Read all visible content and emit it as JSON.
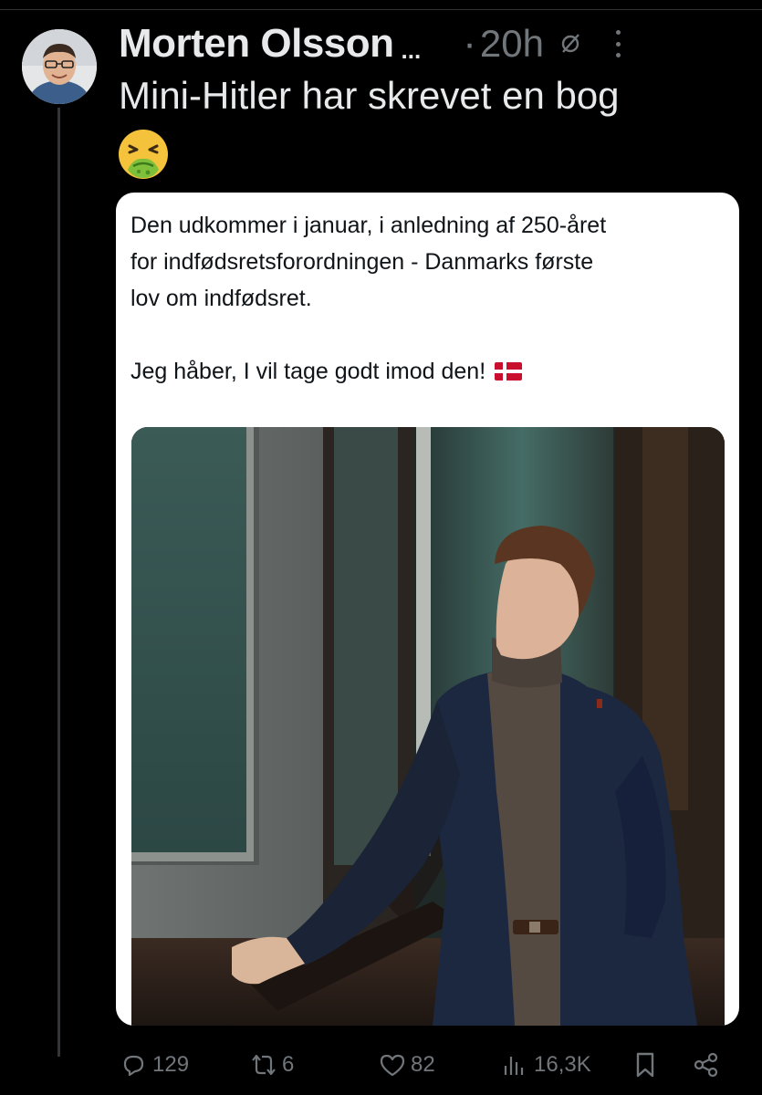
{
  "post": {
    "author": "Morten Olsson",
    "ellipsis": "...",
    "dot": "·",
    "time": "20h",
    "text": "Mini-Hitler har skrevet en bog",
    "emoji": "nauseated-face-emoji"
  },
  "quoted": {
    "line1": "Den udkommer i januar, i anledning af 250-året",
    "line2": "for indfødsretsforordningen - Danmarks første",
    "line3": "lov om indfødsret.",
    "line4": "Jeg håber, I vil tage godt imod den!",
    "flag": "danish-flag-emoji"
  },
  "actions": {
    "replies": "129",
    "reposts": "6",
    "likes": "82",
    "views": "16,3K"
  },
  "colors": {
    "background": "#000000",
    "text": "#e7e9ea",
    "muted": "#71767b",
    "card": "#ffffff",
    "flag_red": "#c8102e"
  },
  "icons": [
    "reply-icon",
    "repost-icon",
    "like-icon",
    "views-icon",
    "bookmark-icon",
    "share-icon",
    "globe-off-icon",
    "more-icon"
  ]
}
